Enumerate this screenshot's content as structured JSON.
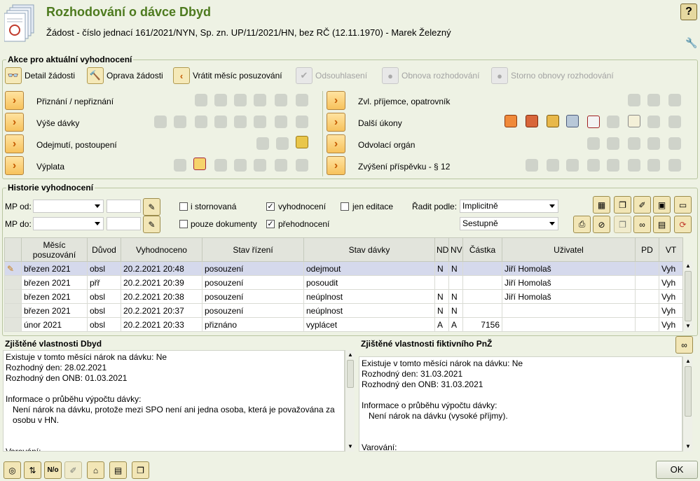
{
  "header": {
    "title": "Rozhodování o dávce Dbyd",
    "subtitle": "Žádost - číslo jednací 161/2021/NYN, Sp. zn. UP/11/2021/HN, bez RČ (12.11.1970) - Marek Železný",
    "help_label": "?"
  },
  "actions": {
    "group_title": "Akce pro aktuální vyhodnocení",
    "detail": "Detail žádosti",
    "oprava": "Oprava žádosti",
    "vratit": "Vrátit měsíc posuzování",
    "odsouhlaseni": "Odsouhlasení",
    "obnova": "Obnova rozhodování",
    "storno": "Storno obnovy rozhodování"
  },
  "rows_left": [
    "Přiznání / nepřiznání",
    "Výše dávky",
    "Odejmutí, postoupení",
    "Výplata"
  ],
  "rows_right": [
    "Zvl. příjemce, opatrovník",
    "Další úkony",
    "Odvolací orgán",
    "Zvýšení příspěvku - § 12"
  ],
  "history": {
    "group_title": "Historie vyhodnocení",
    "mp_od": "MP od:",
    "mp_do": "MP do:",
    "i_stornovana": "i stornovaná",
    "pouze_dokumenty": "pouze dokumenty",
    "vyhodnoceni": "vyhodnocení",
    "prehodnoceni": "přehodnocení",
    "jen_editace": "jen editace",
    "radit_podle": "Řadit podle:",
    "sort_value": "Implicitně",
    "order_value": "Sestupně"
  },
  "table": {
    "headers": {
      "mesic": "Měsíc posuzování",
      "duvod": "Důvod",
      "vyhodnoceno": "Vyhodnoceno",
      "stav_rizeni": "Stav řízení",
      "stav_davky": "Stav dávky",
      "nd": "ND",
      "nv": "NV",
      "castka": "Částka",
      "uzivatel": "Uživatel",
      "pd": "PD",
      "vt": "VT"
    },
    "rows": [
      {
        "mesic": "březen 2021",
        "duvod": "obsl",
        "vyhodnoceno": "20.2.2021 20:48",
        "rizeni": "posouzení",
        "davky": "odejmout",
        "nd": "N",
        "nv": "N",
        "castka": "",
        "uzivatel": "Jiří Homolaš",
        "pd": "",
        "vt": "Vyh"
      },
      {
        "mesic": "březen 2021",
        "duvod": "přř",
        "vyhodnoceno": "20.2.2021 20:39",
        "rizeni": "posouzení",
        "davky": "posoudit",
        "nd": "",
        "nv": "",
        "castka": "",
        "uzivatel": "Jiří Homolaš",
        "pd": "",
        "vt": "Vyh"
      },
      {
        "mesic": "březen 2021",
        "duvod": "obsl",
        "vyhodnoceno": "20.2.2021 20:38",
        "rizeni": "posouzení",
        "davky": "neúplnost",
        "nd": "N",
        "nv": "N",
        "castka": "",
        "uzivatel": "Jiří Homolaš",
        "pd": "",
        "vt": "Vyh"
      },
      {
        "mesic": "březen 2021",
        "duvod": "obsl",
        "vyhodnoceno": "20.2.2021 20:37",
        "rizeni": "posouzení",
        "davky": "neúplnost",
        "nd": "N",
        "nv": "N",
        "castka": "",
        "uzivatel": "",
        "pd": "",
        "vt": "Vyh"
      },
      {
        "mesic": "únor 2021",
        "duvod": "obsl",
        "vyhodnoceno": "20.2.2021 20:33",
        "rizeni": "přiznáno",
        "davky": "vyplácet",
        "nd": "A",
        "nv": "A",
        "castka": "7156",
        "uzivatel": "",
        "pd": "",
        "vt": "Vyh"
      }
    ]
  },
  "panel_left": {
    "title": "Zjištěné vlastnosti Dbyd",
    "text": "Existuje v tomto měsíci nárok na dávku: Ne\nRozhodný den: 28.02.2021\nRozhodný den ONB: 01.03.2021\n\nInformace o průběhu výpočtu dávky:\n   Není nárok na dávku, protože mezi SPO není ani jedna osoba, která je považována za\n   osobu v HN.\n\n\nVarování:"
  },
  "panel_right": {
    "title": "Zjištěné vlastnosti fiktivního PnŽ",
    "text": "Existuje v tomto měsíci nárok na dávku: Ne\nRozhodný den: 31.03.2021\nRozhodný den ONB: 31.03.2021\n\nInformace o průběhu výpočtu dávky:\n   Není nárok na dávku (vysoké příjmy).\n\n\nVarování:"
  },
  "footer": {
    "ok": "OK",
    "no_label": "N/o"
  }
}
